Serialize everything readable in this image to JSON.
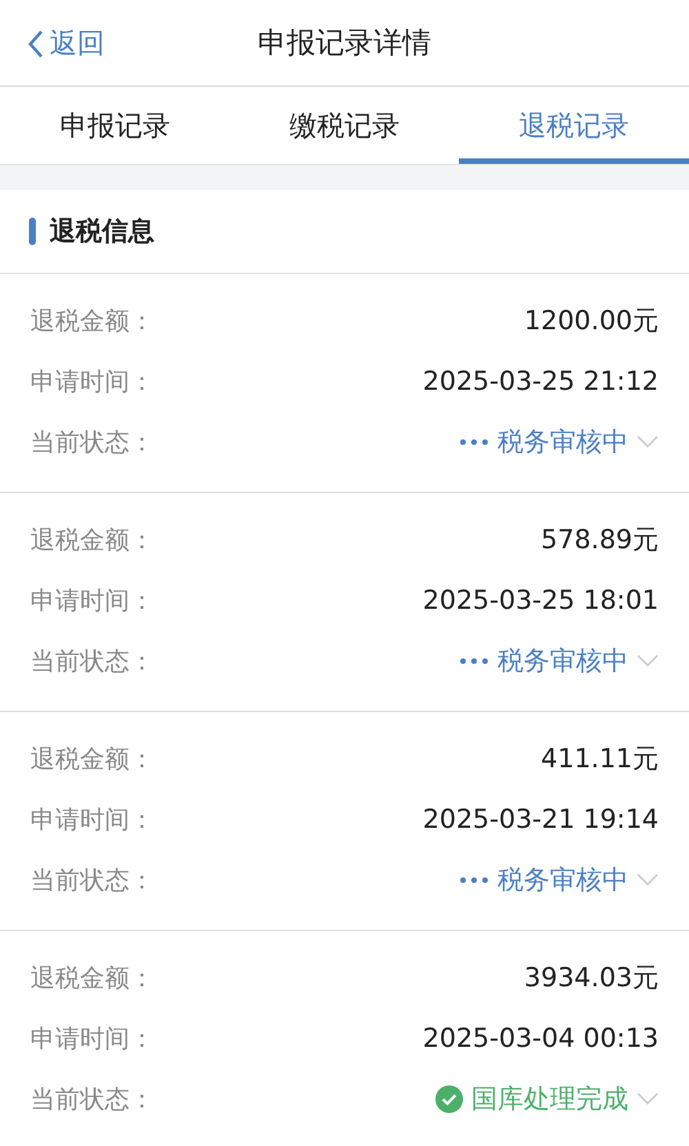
{
  "nav": {
    "back": "返回",
    "title": "申报记录详情"
  },
  "tabs": [
    {
      "label": "申报记录",
      "selected": false
    },
    {
      "label": "缴税记录",
      "selected": false
    },
    {
      "label": "退税记录",
      "selected": true
    }
  ],
  "section_title": "退税信息",
  "records": [
    {
      "amount_label": "退税金额：",
      "amount": "1200.00元",
      "time_label": "申请时间：",
      "time": "2025-03-25 21:12",
      "status_label": "当前状态：",
      "status": "税务审核中",
      "kind": "pending"
    },
    {
      "amount_label": "退税金额：",
      "amount": "578.89元",
      "time_label": "申请时间：",
      "time": "2025-03-25 18:01",
      "status_label": "当前状态：",
      "status": "税务审核中",
      "kind": "pending"
    },
    {
      "amount_label": "退税金额：",
      "amount": "411.11元",
      "time_label": "申请时间：",
      "time": "2025-03-21 19:14",
      "status_label": "当前状态：",
      "status": "税务审核中",
      "kind": "pending"
    },
    {
      "amount_label": "退税金额：",
      "amount": "3934.03元",
      "time_label": "申请时间：",
      "time": "2025-03-04 00:13",
      "status_label": "当前状态：",
      "status": "国库处理完成",
      "kind": "done"
    }
  ]
}
